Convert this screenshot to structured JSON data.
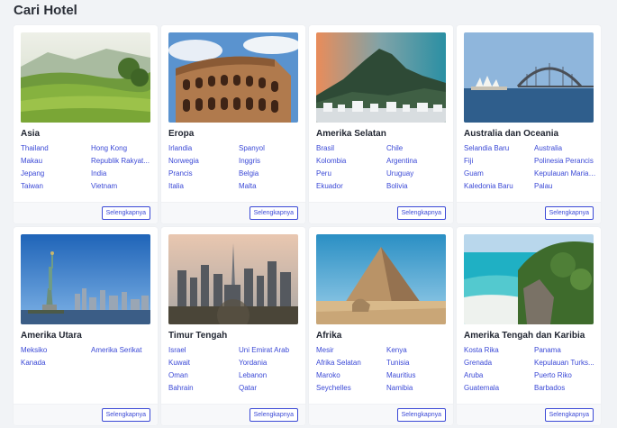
{
  "page": {
    "title": "Cari Hotel"
  },
  "more_label": "Selengkapnya",
  "regions": [
    {
      "name": "Asia",
      "image": "rice-terraces-photo",
      "links": [
        "Thailand",
        "Hong Kong",
        "Makau",
        "Republik Rakyat...",
        "Jepang",
        "India",
        "Taiwan",
        "Vietnam"
      ]
    },
    {
      "name": "Eropa",
      "image": "colosseum-photo",
      "links": [
        "Irlandia",
        "Spanyol",
        "Norwegia",
        "Inggris",
        "Prancis",
        "Belgia",
        "Italia",
        "Malta"
      ]
    },
    {
      "name": "Amerika Selatan",
      "image": "rio-sugarloaf-photo",
      "links": [
        "Brasil",
        "Chile",
        "Kolombia",
        "Argentina",
        "Peru",
        "Uruguay",
        "Ekuador",
        "Bolivia"
      ]
    },
    {
      "name": "Australia dan Oceania",
      "image": "sydney-harbour-photo",
      "links": [
        "Selandia Baru",
        "Australia",
        "Fiji",
        "Polinesia Perancis",
        "Guam",
        "Kepulauan Marian...",
        "Kaledonia Baru",
        "Palau"
      ]
    },
    {
      "name": "Amerika Utara",
      "image": "statue-of-liberty-photo",
      "links": [
        "Meksiko",
        "Amerika Serikat",
        "Kanada"
      ]
    },
    {
      "name": "Timur Tengah",
      "image": "dubai-skyline-photo",
      "links": [
        "Israel",
        "Uni Emirat Arab",
        "Kuwait",
        "Yordania",
        "Oman",
        "Lebanon",
        "Bahrain",
        "Qatar"
      ]
    },
    {
      "name": "Afrika",
      "image": "pyramids-photo",
      "links": [
        "Mesir",
        "Kenya",
        "Afrika Selatan",
        "Tunisia",
        "Maroko",
        "Mauritius",
        "Seychelles",
        "Namibia"
      ]
    },
    {
      "name": "Amerika Tengah dan Karibia",
      "image": "caribbean-beach-photo",
      "links": [
        "Kosta Rika",
        "Panama",
        "Grenada",
        "Kepulauan Turks...",
        "Aruba",
        "Puerto Riko",
        "Guatemala",
        "Barbados"
      ]
    }
  ]
}
